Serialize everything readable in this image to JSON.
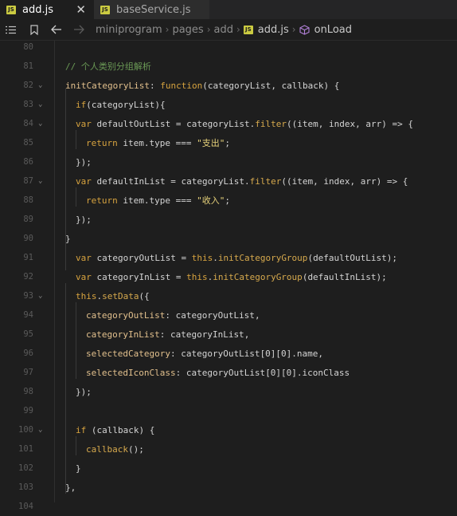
{
  "tabs": [
    {
      "badge": "JS",
      "label": "add.js",
      "close": "✕"
    },
    {
      "badge": "JS",
      "label": "baseService.js"
    }
  ],
  "breadcrumb": {
    "items": [
      "miniprogram",
      "pages",
      "add"
    ],
    "file_badge": "JS",
    "file": "add.js",
    "symbol": "onLoad"
  },
  "editor": {
    "lines": [
      {
        "n": "80",
        "text": ""
      },
      {
        "n": "81",
        "text": "// 个人类别分组解析"
      },
      {
        "n": "82",
        "text": "initCategoryList: function(categoryList, callback) {"
      },
      {
        "n": "83",
        "text": "if(categoryList){"
      },
      {
        "n": "84",
        "text": "var defaultOutList = categoryList.filter((item, index, arr) => {"
      },
      {
        "n": "85",
        "text": "return item.type === \"支出\";"
      },
      {
        "n": "86",
        "text": "});"
      },
      {
        "n": "87",
        "text": "var defaultInList = categoryList.filter((item, index, arr) => {"
      },
      {
        "n": "88",
        "text": "return item.type === \"收入\";"
      },
      {
        "n": "89",
        "text": "});"
      },
      {
        "n": "90",
        "text": "}"
      },
      {
        "n": "91",
        "text": "var categoryOutList = this.initCategoryGroup(defaultOutList);"
      },
      {
        "n": "92",
        "text": "var categoryInList = this.initCategoryGroup(defaultInList);"
      },
      {
        "n": "93",
        "text": "this.setData({"
      },
      {
        "n": "94",
        "text": "categoryOutList: categoryOutList,"
      },
      {
        "n": "95",
        "text": "categoryInList: categoryInList,"
      },
      {
        "n": "96",
        "text": "selectedCategory: categoryOutList[0][0].name,"
      },
      {
        "n": "97",
        "text": "selectedIconClass: categoryOutList[0][0].iconClass"
      },
      {
        "n": "98",
        "text": "});"
      },
      {
        "n": "99",
        "text": ""
      },
      {
        "n": "100",
        "text": "if (callback) {"
      },
      {
        "n": "101",
        "text": "callback();"
      },
      {
        "n": "102",
        "text": "}"
      },
      {
        "n": "103",
        "text": "},"
      },
      {
        "n": "104",
        "text": ""
      }
    ]
  }
}
